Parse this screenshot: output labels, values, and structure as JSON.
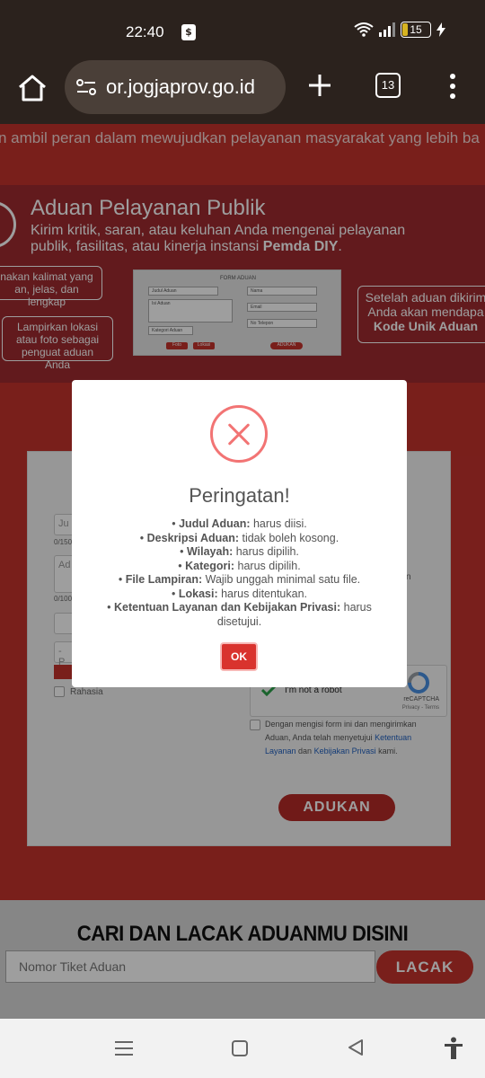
{
  "status_bar": {
    "time": "22:40",
    "battery": "15"
  },
  "browser": {
    "url": "or.jogjaprov.go.id",
    "tab_count": "13"
  },
  "page": {
    "tagline": "n ambil peran dalam mewujudkan pelayanan masyarakat yang lebih ba",
    "banner": {
      "title": "Aduan Pelayanan Publik",
      "subtitle": "Kirim kritik, saran, atau keluhan Anda mengenai pelayanan publik, fasilitas, atau kinerja instansi ",
      "subtitle_bold": "Pemda DIY",
      "subtitle_end": ".",
      "callout_left_top": "nakan kalimat yang an, jelas, dan lengkap",
      "callout_left_bottom": "Lampirkan lokasi atau foto sebagai penguat aduan Anda",
      "callout_right": "Setelah aduan dikirim Anda akan mendapa",
      "callout_right_bold": "Kode Unik Aduan",
      "mock": {
        "title": "FORM ADUAN",
        "judul": "Judul Aduan",
        "isi": "Isi Aduan",
        "kategori": "Kategori Aduan",
        "nama": "Nama",
        "email": "Email",
        "telepon": "No Telepon",
        "foto": "Foto",
        "lokasi": "Lokasi",
        "submit": "ADUKAN"
      }
    },
    "form": {
      "judul_placeholder": "Ju",
      "counter_judul": "0/150",
      "deskripsi_placeholder": "Ad",
      "counter_deskripsi": "0/100",
      "select_placeholder": "- P",
      "right_stub": "n",
      "rahasia": "Rahasia",
      "captcha_text": "I'm not a robot",
      "captcha_brand": "reCAPTCHA",
      "captcha_privacy": "Privacy - Terms",
      "agree_prefix": "Dengan mengisi form ini dan mengirimkan Aduan, Anda telah menyetujui ",
      "agree_link1": "Ketentuan Layanan",
      "agree_mid": " dan ",
      "agree_link2": "Kebijakan Privasi",
      "agree_suffix": " kami.",
      "submit": "ADUKAN"
    },
    "search": {
      "title": "CARI DAN LACAK ADUANMU DISINI",
      "placeholder": "Nomor Tiket Aduan",
      "button": "LACAK"
    }
  },
  "modal": {
    "title": "Peringatan!",
    "items": [
      {
        "label": "Judul Aduan:",
        "text": " harus diisi."
      },
      {
        "label": "Deskripsi Aduan:",
        "text": " tidak boleh kosong."
      },
      {
        "label": "Wilayah:",
        "text": " harus dipilih."
      },
      {
        "label": "Kategori:",
        "text": " harus dipilih."
      },
      {
        "label": "File Lampiran:",
        "text": " Wajib unggah minimal satu file."
      },
      {
        "label": "Lokasi:",
        "text": " harus ditentukan."
      },
      {
        "label": "Ketentuan Layanan dan Kebijakan Privasi:",
        "text": " harus disetujui."
      }
    ],
    "ok": "OK"
  },
  "colors": {
    "brand_red": "#c4322d",
    "error_icon": "#f27474",
    "ok_button": "#d9332e"
  }
}
